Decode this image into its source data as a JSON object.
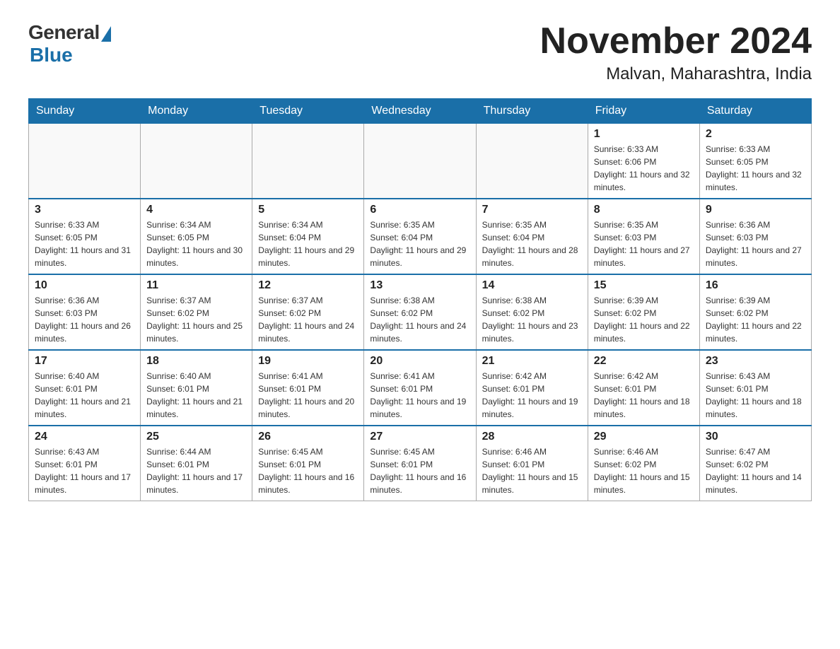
{
  "header": {
    "logo": {
      "general": "General",
      "blue": "Blue"
    },
    "month_title": "November 2024",
    "location": "Malvan, Maharashtra, India"
  },
  "calendar": {
    "weekdays": [
      "Sunday",
      "Monday",
      "Tuesday",
      "Wednesday",
      "Thursday",
      "Friday",
      "Saturday"
    ],
    "weeks": [
      [
        {
          "day": "",
          "info": ""
        },
        {
          "day": "",
          "info": ""
        },
        {
          "day": "",
          "info": ""
        },
        {
          "day": "",
          "info": ""
        },
        {
          "day": "",
          "info": ""
        },
        {
          "day": "1",
          "info": "Sunrise: 6:33 AM\nSunset: 6:06 PM\nDaylight: 11 hours and 32 minutes."
        },
        {
          "day": "2",
          "info": "Sunrise: 6:33 AM\nSunset: 6:05 PM\nDaylight: 11 hours and 32 minutes."
        }
      ],
      [
        {
          "day": "3",
          "info": "Sunrise: 6:33 AM\nSunset: 6:05 PM\nDaylight: 11 hours and 31 minutes."
        },
        {
          "day": "4",
          "info": "Sunrise: 6:34 AM\nSunset: 6:05 PM\nDaylight: 11 hours and 30 minutes."
        },
        {
          "day": "5",
          "info": "Sunrise: 6:34 AM\nSunset: 6:04 PM\nDaylight: 11 hours and 29 minutes."
        },
        {
          "day": "6",
          "info": "Sunrise: 6:35 AM\nSunset: 6:04 PM\nDaylight: 11 hours and 29 minutes."
        },
        {
          "day": "7",
          "info": "Sunrise: 6:35 AM\nSunset: 6:04 PM\nDaylight: 11 hours and 28 minutes."
        },
        {
          "day": "8",
          "info": "Sunrise: 6:35 AM\nSunset: 6:03 PM\nDaylight: 11 hours and 27 minutes."
        },
        {
          "day": "9",
          "info": "Sunrise: 6:36 AM\nSunset: 6:03 PM\nDaylight: 11 hours and 27 minutes."
        }
      ],
      [
        {
          "day": "10",
          "info": "Sunrise: 6:36 AM\nSunset: 6:03 PM\nDaylight: 11 hours and 26 minutes."
        },
        {
          "day": "11",
          "info": "Sunrise: 6:37 AM\nSunset: 6:02 PM\nDaylight: 11 hours and 25 minutes."
        },
        {
          "day": "12",
          "info": "Sunrise: 6:37 AM\nSunset: 6:02 PM\nDaylight: 11 hours and 24 minutes."
        },
        {
          "day": "13",
          "info": "Sunrise: 6:38 AM\nSunset: 6:02 PM\nDaylight: 11 hours and 24 minutes."
        },
        {
          "day": "14",
          "info": "Sunrise: 6:38 AM\nSunset: 6:02 PM\nDaylight: 11 hours and 23 minutes."
        },
        {
          "day": "15",
          "info": "Sunrise: 6:39 AM\nSunset: 6:02 PM\nDaylight: 11 hours and 22 minutes."
        },
        {
          "day": "16",
          "info": "Sunrise: 6:39 AM\nSunset: 6:02 PM\nDaylight: 11 hours and 22 minutes."
        }
      ],
      [
        {
          "day": "17",
          "info": "Sunrise: 6:40 AM\nSunset: 6:01 PM\nDaylight: 11 hours and 21 minutes."
        },
        {
          "day": "18",
          "info": "Sunrise: 6:40 AM\nSunset: 6:01 PM\nDaylight: 11 hours and 21 minutes."
        },
        {
          "day": "19",
          "info": "Sunrise: 6:41 AM\nSunset: 6:01 PM\nDaylight: 11 hours and 20 minutes."
        },
        {
          "day": "20",
          "info": "Sunrise: 6:41 AM\nSunset: 6:01 PM\nDaylight: 11 hours and 19 minutes."
        },
        {
          "day": "21",
          "info": "Sunrise: 6:42 AM\nSunset: 6:01 PM\nDaylight: 11 hours and 19 minutes."
        },
        {
          "day": "22",
          "info": "Sunrise: 6:42 AM\nSunset: 6:01 PM\nDaylight: 11 hours and 18 minutes."
        },
        {
          "day": "23",
          "info": "Sunrise: 6:43 AM\nSunset: 6:01 PM\nDaylight: 11 hours and 18 minutes."
        }
      ],
      [
        {
          "day": "24",
          "info": "Sunrise: 6:43 AM\nSunset: 6:01 PM\nDaylight: 11 hours and 17 minutes."
        },
        {
          "day": "25",
          "info": "Sunrise: 6:44 AM\nSunset: 6:01 PM\nDaylight: 11 hours and 17 minutes."
        },
        {
          "day": "26",
          "info": "Sunrise: 6:45 AM\nSunset: 6:01 PM\nDaylight: 11 hours and 16 minutes."
        },
        {
          "day": "27",
          "info": "Sunrise: 6:45 AM\nSunset: 6:01 PM\nDaylight: 11 hours and 16 minutes."
        },
        {
          "day": "28",
          "info": "Sunrise: 6:46 AM\nSunset: 6:01 PM\nDaylight: 11 hours and 15 minutes."
        },
        {
          "day": "29",
          "info": "Sunrise: 6:46 AM\nSunset: 6:02 PM\nDaylight: 11 hours and 15 minutes."
        },
        {
          "day": "30",
          "info": "Sunrise: 6:47 AM\nSunset: 6:02 PM\nDaylight: 11 hours and 14 minutes."
        }
      ]
    ]
  }
}
